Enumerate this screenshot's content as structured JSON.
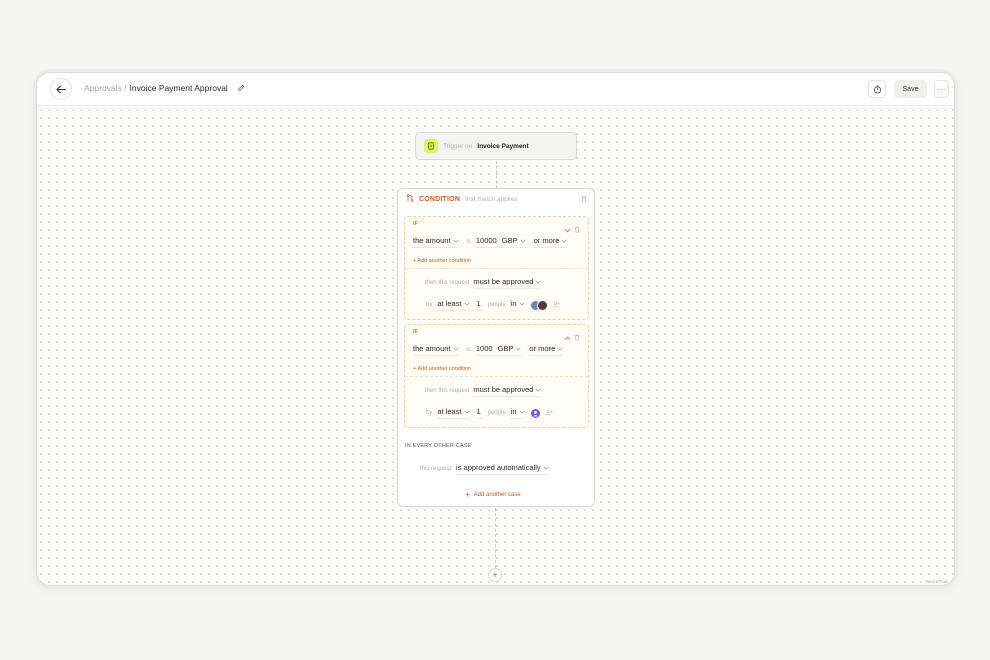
{
  "header": {
    "breadcrumb_parent": "Approvals /",
    "title": "Invoice Payment Approval",
    "save_label": "Save",
    "more_label": "···"
  },
  "trigger": {
    "prefix": "Trigger on",
    "name": "Invoice Payment"
  },
  "condition": {
    "title": "CONDITION",
    "subtitle": "first match applies",
    "cases": [
      {
        "if_label": "IF",
        "field": "the amount",
        "operator": "is",
        "amount": "10000",
        "currency": "GBP",
        "comparison": "or more",
        "add_condition": "+ Add another condition",
        "then_label": "then this request",
        "action": "must be approved",
        "by_label": "by",
        "quantifier": "at least",
        "count": "1",
        "people_label": "people",
        "in_label": "in",
        "collapse_icon": "chevron-down-icon"
      },
      {
        "if_label": "IF",
        "field": "the amount",
        "operator": "is",
        "amount": "1000",
        "currency": "GBP",
        "comparison": "or more",
        "add_condition": "+ Add another condition",
        "then_label": "then this request",
        "action": "must be approved",
        "by_label": "by",
        "quantifier": "at least",
        "count": "1",
        "people_label": "people",
        "in_label": "in",
        "collapse_icon": "chevron-up-icon"
      }
    ],
    "other_case_label": "IN EVERY OTHER CASE",
    "other_prefix": "this request",
    "other_action": "is approved automatically",
    "add_case": "Add another case"
  },
  "footer": {
    "attribution": "React Flow"
  },
  "colors": {
    "accent": "#cf5a2a",
    "case_border": "#e6d78c",
    "trigger_icon_bg": "#dff36a",
    "avatar_purple": "#6b5be6"
  }
}
